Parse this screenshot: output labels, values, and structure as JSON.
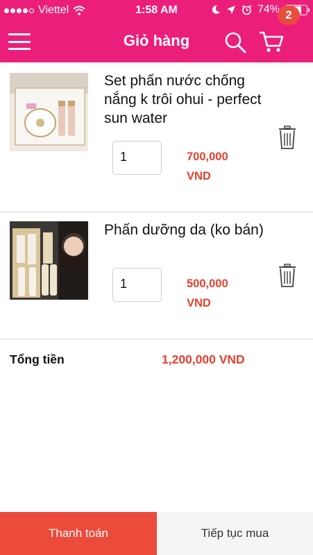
{
  "status_bar": {
    "carrier": "Viettel",
    "time": "1:58 AM",
    "battery": "74%",
    "battery_level": 0.74,
    "signal_bars": 4
  },
  "header": {
    "title": "Giỏ hàng",
    "cart_count": "2"
  },
  "cart": {
    "items": [
      {
        "name": "Set phấn nước chống nắng k trôi ohui - perfect sun water",
        "quantity": "1",
        "price": "700,000 VND"
      },
      {
        "name": "Phấn dưỡng da (ko bán)",
        "quantity": "1",
        "price": "500,000 VND"
      }
    ],
    "total_label": "Tổng tiền",
    "total_value": "1,200,000 VND"
  },
  "footer": {
    "checkout_label": "Thanh toán",
    "continue_label": "Tiếp tục mua"
  },
  "colors": {
    "header": "#ec1e7b",
    "price": "#e8402e",
    "checkout_button": "#ec4b3b",
    "badge": "#e94b3c"
  }
}
